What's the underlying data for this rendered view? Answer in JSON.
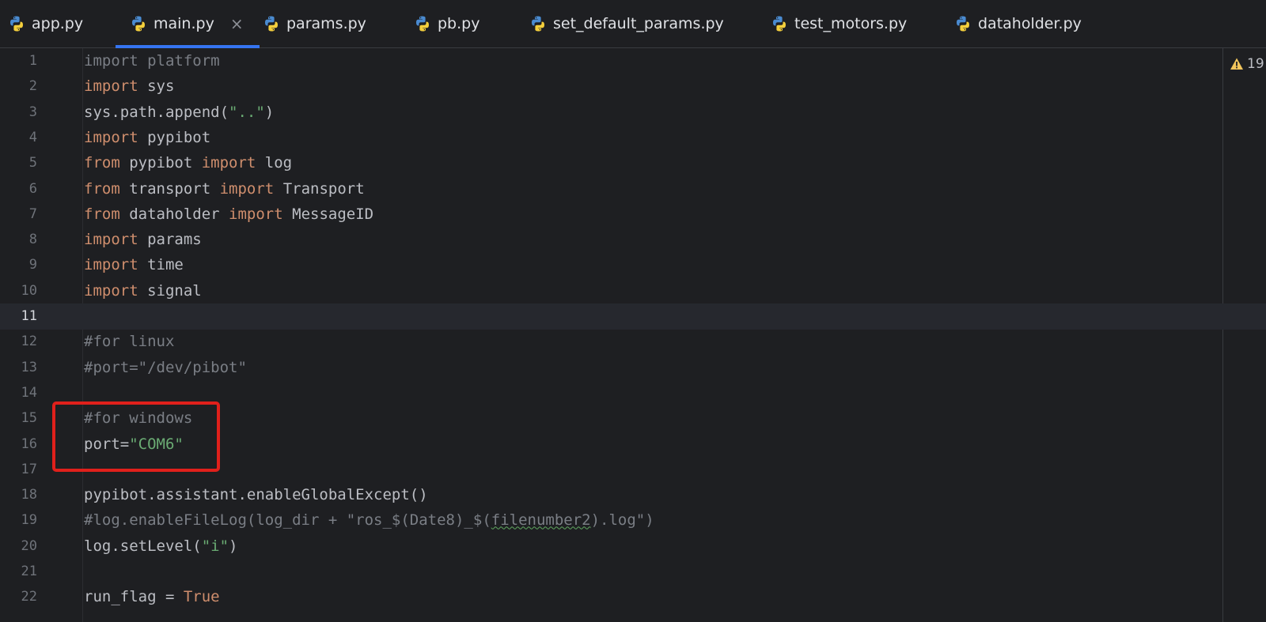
{
  "tabs": [
    {
      "label": "app.py",
      "active": false
    },
    {
      "label": "main.py",
      "active": true
    },
    {
      "label": "params.py",
      "active": false
    },
    {
      "label": "pb.py",
      "active": false
    },
    {
      "label": "set_default_params.py",
      "active": false
    },
    {
      "label": "test_motors.py",
      "active": false
    },
    {
      "label": "dataholder.py",
      "active": false
    }
  ],
  "tab_close_glyph": "×",
  "warnings": {
    "count": "19",
    "icon": "warning-triangle-icon"
  },
  "current_line": 11,
  "code_lines": [
    [
      {
        "t": "import platform",
        "c": "dim"
      }
    ],
    [
      {
        "t": "import",
        "c": "kw"
      },
      {
        "t": " sys",
        "c": ""
      }
    ],
    [
      {
        "t": "sys.path.append(",
        "c": ""
      },
      {
        "t": "\"..\"",
        "c": "str"
      },
      {
        "t": ")",
        "c": ""
      }
    ],
    [
      {
        "t": "import",
        "c": "kw"
      },
      {
        "t": " pypibot",
        "c": ""
      }
    ],
    [
      {
        "t": "from",
        "c": "kw"
      },
      {
        "t": " pypibot ",
        "c": ""
      },
      {
        "t": "import",
        "c": "kw"
      },
      {
        "t": " log",
        "c": ""
      }
    ],
    [
      {
        "t": "from",
        "c": "kw"
      },
      {
        "t": " transport ",
        "c": ""
      },
      {
        "t": "import",
        "c": "kw"
      },
      {
        "t": " Transport",
        "c": ""
      }
    ],
    [
      {
        "t": "from",
        "c": "kw"
      },
      {
        "t": " dataholder ",
        "c": ""
      },
      {
        "t": "import",
        "c": "kw"
      },
      {
        "t": " MessageID",
        "c": ""
      }
    ],
    [
      {
        "t": "import",
        "c": "kw"
      },
      {
        "t": " params",
        "c": ""
      }
    ],
    [
      {
        "t": "import",
        "c": "kw"
      },
      {
        "t": " time",
        "c": ""
      }
    ],
    [
      {
        "t": "import",
        "c": "kw"
      },
      {
        "t": " signal",
        "c": ""
      }
    ],
    [],
    [
      {
        "t": "#for linux",
        "c": "cm"
      }
    ],
    [
      {
        "t": "#port=\"/dev/pibot\"",
        "c": "cm"
      }
    ],
    [],
    [
      {
        "t": "#for windows",
        "c": "cm"
      }
    ],
    [
      {
        "t": "port=",
        "c": ""
      },
      {
        "t": "\"COM6\"",
        "c": "str"
      }
    ],
    [],
    [
      {
        "t": "pypibot.assistant.enableGlobalExcept()",
        "c": ""
      }
    ],
    [
      {
        "t": "#log.enableFileLog(log_dir + \"ros_$(Date8)_$(",
        "c": "cm"
      },
      {
        "t": "filenumber2",
        "c": "cm wavy"
      },
      {
        "t": ").log\")",
        "c": "cm"
      }
    ],
    [
      {
        "t": "log.setLevel(",
        "c": ""
      },
      {
        "t": "\"i\"",
        "c": "str"
      },
      {
        "t": ")",
        "c": ""
      }
    ],
    [],
    [
      {
        "t": "run_flag = ",
        "c": ""
      },
      {
        "t": "True",
        "c": "kw"
      }
    ]
  ]
}
